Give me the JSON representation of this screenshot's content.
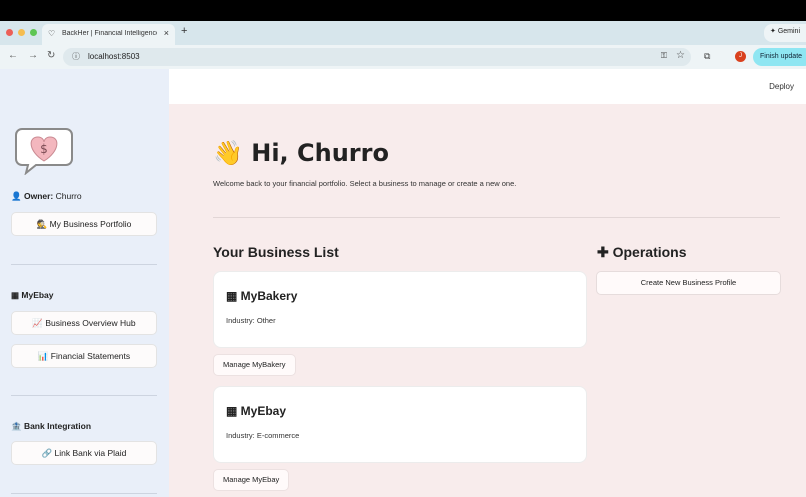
{
  "browser": {
    "tab_title": "BackHer | Financial Intelligence",
    "tab_close": "×",
    "new_tab": "+",
    "url": "localhost:8503",
    "gemini_label": "✦ Gemini",
    "avatar_letter": "J",
    "finish_update": "Finish update"
  },
  "header": {
    "deploy": "Deploy"
  },
  "sidebar": {
    "owner_label": "Owner:",
    "owner_name": "Churro",
    "owner_icon": "👤",
    "portfolio_button": "🕵️ My Business Portfolio",
    "business_section": "▦ MyEbay",
    "overview_button": "📈 Business Overview Hub",
    "statements_button": "📊 Financial Statements",
    "bank_section": "🏦 Bank Integration",
    "plaid_button": "🔗 Link Bank via Plaid",
    "logo_symbol": "$"
  },
  "main": {
    "greeting": "👋 Hi, Churro",
    "welcome": "Welcome back to your financial portfolio. Select a business to manage or create a new one.",
    "list_title": "Your Business List",
    "operations_title": "✚ Operations",
    "create_button": "Create New Business Profile",
    "businesses": [
      {
        "name": "▦ MyBakery",
        "industry": "Industry: Other",
        "manage": "Manage MyBakery"
      },
      {
        "name": "▦ MyEbay",
        "industry": "Industry: E-commerce",
        "manage": "Manage MyEbay"
      }
    ]
  },
  "colors": {
    "sidebar_bg": "#e9eff9",
    "main_bg": "#f8ecec",
    "accent_cyan": "#8fe6f2"
  }
}
